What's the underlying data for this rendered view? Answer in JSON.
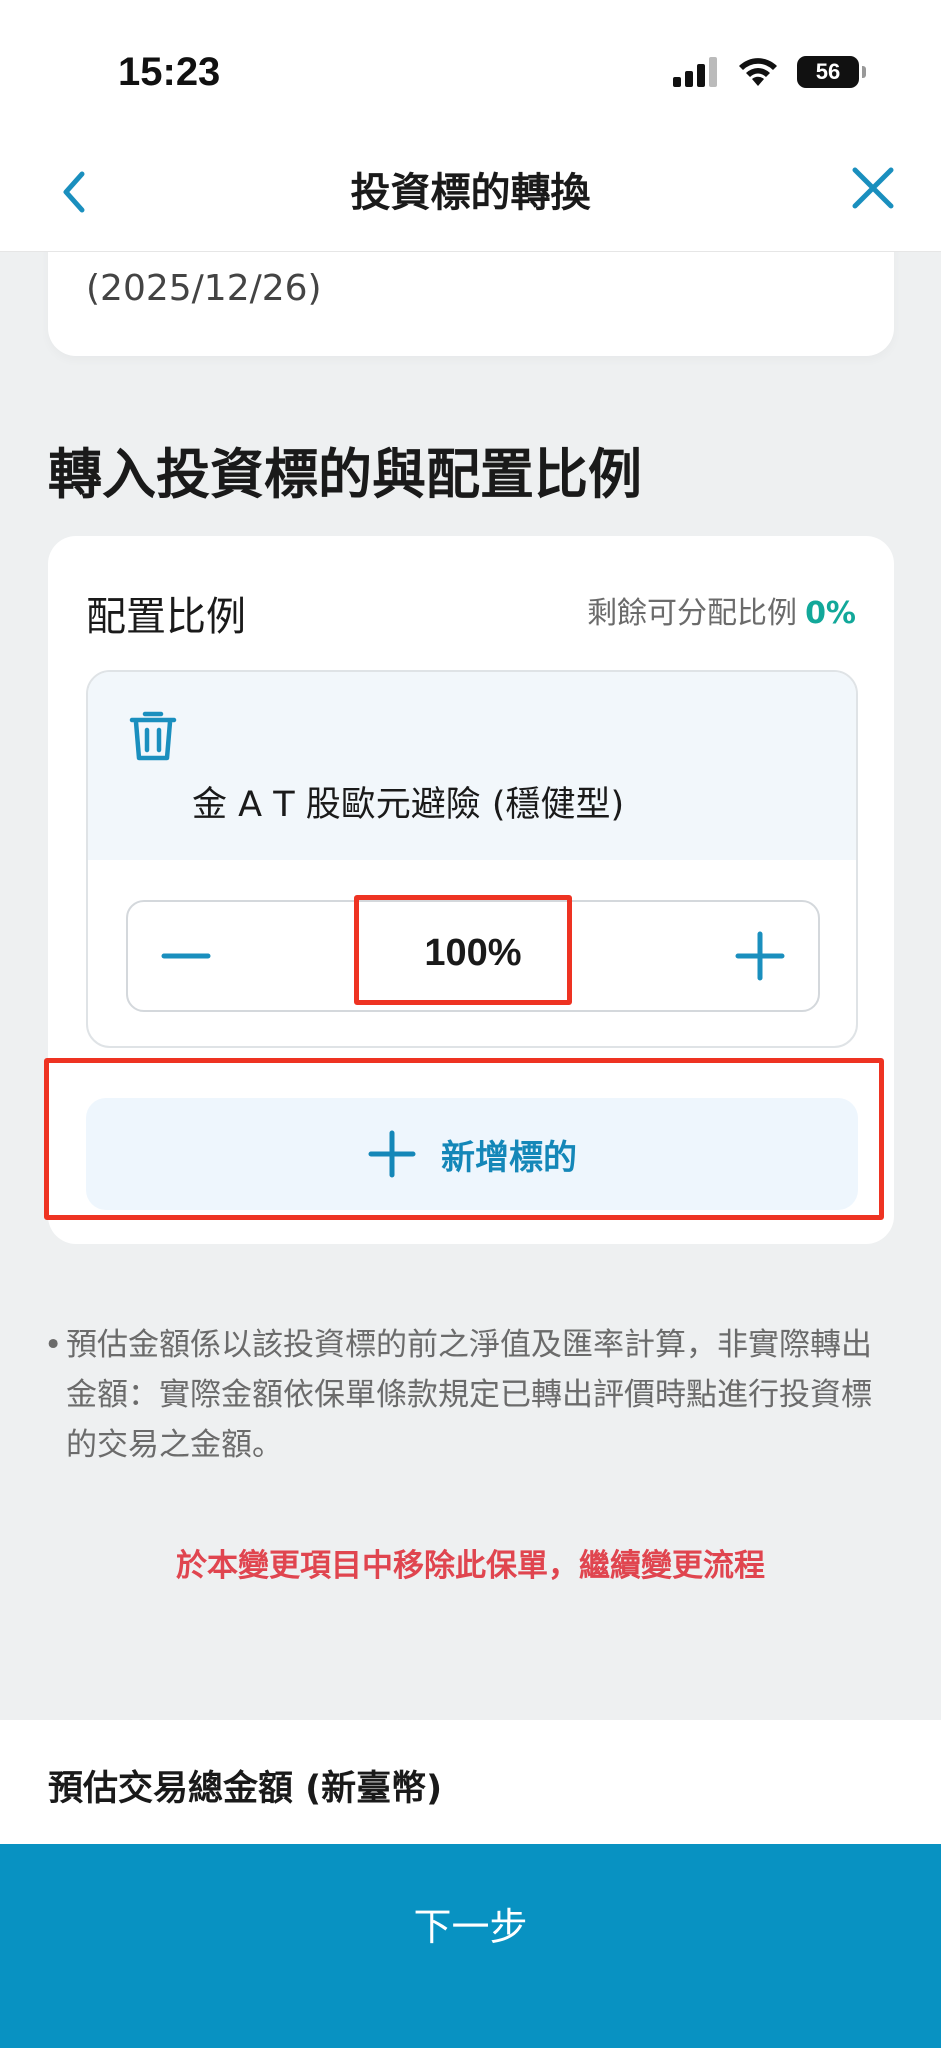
{
  "status_bar": {
    "time": "15:23",
    "battery": "56"
  },
  "nav": {
    "title": "投資標的轉換",
    "back_icon": "chevron-left-icon",
    "close_icon": "close-icon"
  },
  "top_card": {
    "date": "(2025/12/26)"
  },
  "section": {
    "title": "轉入投資標的與配置比例"
  },
  "allocation": {
    "label": "配置比例",
    "remaining_label": "剩餘可分配比例",
    "remaining_value": "0%",
    "funds": [
      {
        "name": "金 A T 股歐元避險 (穩健型)",
        "percent": "100%"
      }
    ],
    "add_button_label": "新增標的"
  },
  "note": {
    "text": "預估金額係以該投資標的前之淨值及匯率計算，非實際轉出金額：實際金額依保單條款規定已轉出評價時點進行投資標的交易之金額。"
  },
  "remove_link": "於本變更項目中移除此保單，繼續變更流程",
  "footer": {
    "total_label": "預估交易總金額 (新臺幣)",
    "next_label": "下一步"
  },
  "colors": {
    "accent": "#0892c2",
    "teal": "#12a89a",
    "warning": "#e0454f",
    "annotation": "#ee3322"
  }
}
